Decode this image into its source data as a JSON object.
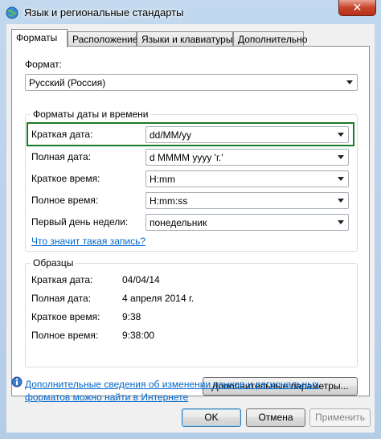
{
  "window": {
    "title": "Язык и региональные стандарты",
    "close_glyph": "✕"
  },
  "tabs": [
    {
      "label": "Форматы"
    },
    {
      "label": "Расположение"
    },
    {
      "label": "Языки и клавиатуры"
    },
    {
      "label": "Дополнительно"
    }
  ],
  "format": {
    "label": "Формат:",
    "value": "Русский (Россия)"
  },
  "datetime_group": {
    "title": "Форматы даты и времени",
    "short_date": {
      "label": "Краткая дата:",
      "value": "dd/MM/yy"
    },
    "long_date": {
      "label": "Полная дата:",
      "value": "d MMMM yyyy 'г.'"
    },
    "short_time": {
      "label": "Краткое время:",
      "value": "H:mm"
    },
    "long_time": {
      "label": "Полное время:",
      "value": "H:mm:ss"
    },
    "first_day": {
      "label": "Первый день недели:",
      "value": "понедельник"
    },
    "notation_link": "Что значит такая запись?"
  },
  "samples": {
    "title": "Образцы",
    "short_date": {
      "label": "Краткая дата:",
      "value": "04/04/14"
    },
    "long_date": {
      "label": "Полная дата:",
      "value": "4 апреля 2014 г."
    },
    "short_time": {
      "label": "Краткое время:",
      "value": "9:38"
    },
    "long_time": {
      "label": "Полное время:",
      "value": "9:38:00"
    }
  },
  "additional_settings_button": "Дополнительные параметры...",
  "info_link_line1": "Дополнительные сведения об изменении языков и региональных",
  "info_link_line2": "форматов можно найти в Интернете",
  "buttons": {
    "ok": "OK",
    "cancel": "Отмена",
    "apply": "Применить"
  },
  "colors": {
    "highlight_border": "#1a7a22",
    "link": "#0066cc"
  }
}
